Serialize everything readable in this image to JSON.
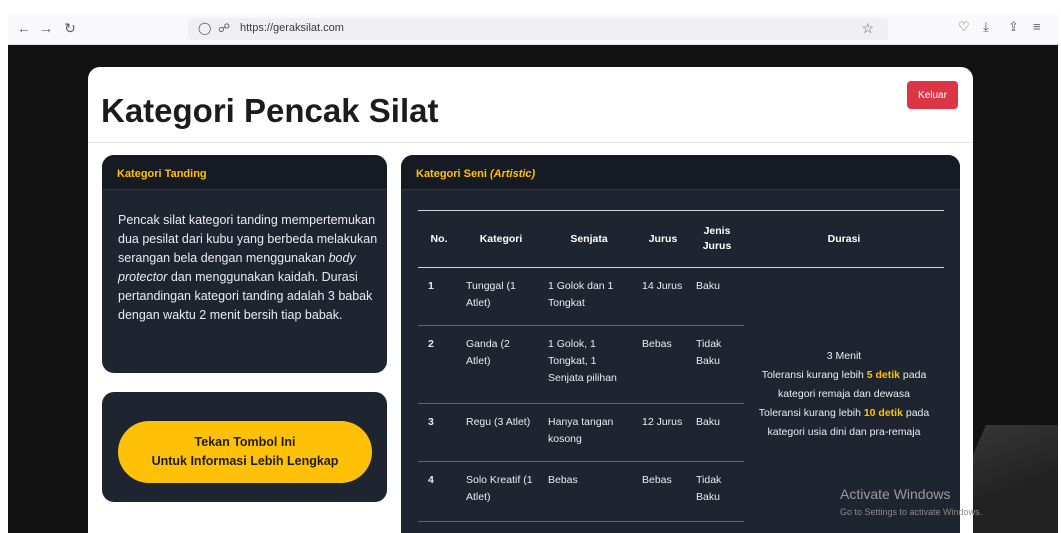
{
  "browser": {
    "url": "https://geraksilat.com"
  },
  "page": {
    "title": "Kategori Pencak Silat",
    "logout_label": "Keluar"
  },
  "tanding": {
    "header": "Kategori Tanding",
    "text_1": "Pencak silat kategori tanding mempertemukan dua pesilat dari kubu yang berbeda melakukan serangan bela dengan menggunakan ",
    "text_em": "body protector",
    "text_2": " dan menggunakan kaidah. Durasi pertandingan kategori tanding adalah 3 babak dengan waktu 2 menit bersih tiap babak."
  },
  "info_button": {
    "line1": "Tekan Tombol Ini",
    "line2": "Untuk Informasi Lebih Lengkap"
  },
  "seni": {
    "header": "Kategori Seni ",
    "header_em": "(Artistic)",
    "columns": [
      "No.",
      "Kategori",
      "Senjata",
      "Jurus",
      "Jenis Jurus",
      "Durasi"
    ],
    "rows": [
      {
        "no": "1",
        "kategori": "Tunggal (1 Atlet)",
        "senjata": "1 Golok dan 1 Tongkat",
        "jurus": "14 Jurus",
        "jenis": "Baku"
      },
      {
        "no": "2",
        "kategori": "Ganda (2 Atlet)",
        "senjata": "1 Golok, 1 Tongkat, 1 Senjata pilihan",
        "jurus": "Bebas",
        "jenis": "Tidak Baku"
      },
      {
        "no": "3",
        "kategori": "Regu (3 Atlet)",
        "senjata": "Hanya tangan kosong",
        "jurus": "12 Jurus",
        "jenis": "Baku"
      },
      {
        "no": "4",
        "kategori": "Solo Kreatif (1 Atlet)",
        "senjata": "Bebas",
        "jurus": "Bebas",
        "jenis": "Tidak Baku"
      }
    ],
    "durasi": {
      "line1": "3 Menit",
      "line2a": "Toleransi kurang lebih ",
      "line2b": "5 detik",
      "line3": " pada kategori remaja dan dewasa",
      "line4a": "Toleransi kurang lebih ",
      "line4b": "10 detik",
      "line5": " pada kategori usia dini dan pra-remaja"
    }
  },
  "watermark": {
    "title": "Activate Windows",
    "subtitle": "Go to Settings to activate Windows."
  },
  "colors": {
    "accent": "#ffc107",
    "logout": "#dc3545",
    "panel": "#1f2530",
    "page_bg": "#121212"
  },
  "icons": [
    "back-arrow-icon",
    "forward-arrow-icon",
    "reload-icon",
    "shield-icon",
    "lock-icon",
    "star-icon",
    "pocket-icon",
    "download-icon",
    "share-icon",
    "menu-icon"
  ]
}
